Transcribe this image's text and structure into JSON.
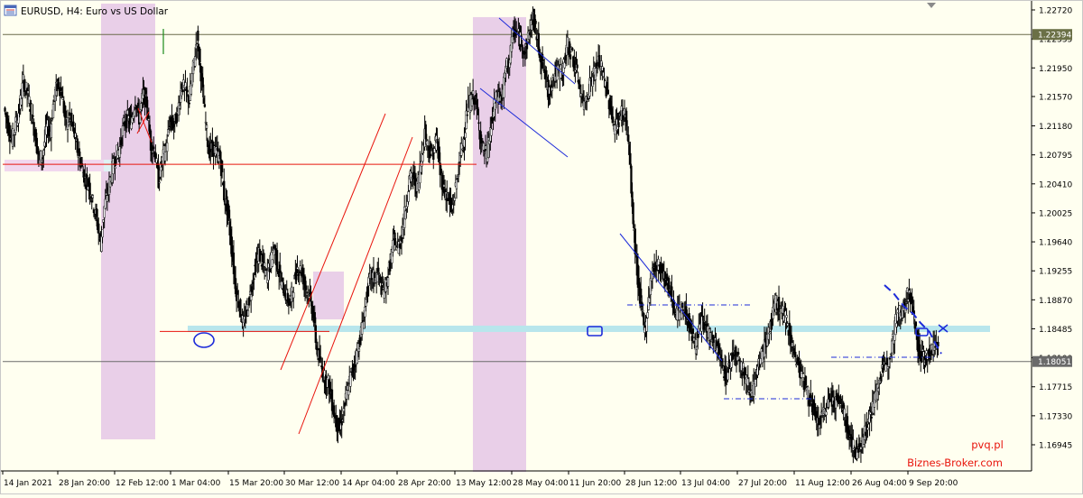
{
  "header": {
    "title": "EURUSD, H4:  Euro vs US Dollar",
    "icon": "chart-window-icon"
  },
  "watermark": {
    "line1": "pvq.pl",
    "line2": "Biznes-Broker.com",
    "color": "#e8140c"
  },
  "colors": {
    "background": "#fffff0",
    "candles": "#000000",
    "zone": "#e9cfe8",
    "support_band": "#b8e6ec",
    "red_lines": "#e8140c",
    "blue_lines": "#1d2bd9",
    "grid_line": "#7a7a7a",
    "price_line": "#6a6a6a"
  },
  "chart_data": {
    "type": "line",
    "symbol": "EURUSD",
    "timeframe": "H4",
    "title": "EURUSD, H4:  Euro vs US Dollar",
    "ylim": [
      1.1665,
      1.2275
    ],
    "y_ticks": [
      1.2272,
      1.22335,
      1.2195,
      1.2157,
      1.2118,
      1.20795,
      1.2041,
      1.20025,
      1.1964,
      1.19255,
      1.1887,
      1.18485,
      1.181,
      1.17715,
      1.1733,
      1.16945
    ],
    "y_tick_labels": [
      "1.22720",
      "1.22335",
      "1.21950",
      "1.21570",
      "1.21180",
      "1.20795",
      "1.20410",
      "1.20025",
      "1.19640",
      "1.19255",
      "1.18870",
      "1.18485",
      "1.18100",
      "1.17715",
      "1.17330",
      "1.16945"
    ],
    "x_tick_labels": [
      "14 Jan 2021",
      "28 Jan 20:00",
      "12 Feb 12:00",
      "1 Mar 04:00",
      "15 Mar 20:00",
      "30 Mar 12:00",
      "14 Apr 04:00",
      "28 Apr 20:00",
      "13 May 12:00",
      "28 May 04:00",
      "11 Jun 20:00",
      "28 Jun 12:00",
      "13 Jul 04:00",
      "27 Jul 20:00",
      "11 Aug 12:00",
      "26 Aug 04:00",
      "9 Sep 20:00"
    ],
    "price_labels": [
      {
        "value": 1.22394,
        "label": "1.22394",
        "style": "level"
      },
      {
        "value": 1.18051,
        "label": "1.18051",
        "style": "current"
      }
    ],
    "series": [
      {
        "values": [
          1.2142,
          1.2118,
          1.2098,
          1.2121,
          1.2142,
          1.2178,
          1.2162,
          1.2139,
          1.2107,
          1.2075,
          1.2078,
          1.2116,
          1.2112,
          1.2158,
          1.2176,
          1.2161,
          1.2119,
          1.2129,
          1.2112,
          1.2086,
          1.2066,
          1.2047,
          1.204,
          1.2016,
          1.1994,
          1.196,
          1.201,
          1.2034,
          1.206,
          1.2079,
          1.2089,
          1.212,
          1.2128,
          1.2123,
          1.2154,
          1.2128,
          1.2161,
          1.2147,
          1.2093,
          1.2085,
          1.2045,
          1.2072,
          1.2092,
          1.2124,
          1.2119,
          1.2137,
          1.2173,
          1.2165,
          1.2151,
          1.2195,
          1.2236,
          1.2188,
          1.2134,
          1.2084,
          1.2089,
          1.2082,
          1.2075,
          1.2025,
          1.2003,
          1.1953,
          1.1903,
          1.1877,
          1.1852,
          1.1875,
          1.1901,
          1.193,
          1.1949,
          1.1934,
          1.1919,
          1.1937,
          1.1957,
          1.1928,
          1.1906,
          1.1894,
          1.1881,
          1.1907,
          1.193,
          1.1926,
          1.1906,
          1.1892,
          1.1872,
          1.1822,
          1.1802,
          1.1784,
          1.1777,
          1.175,
          1.1724,
          1.1715,
          1.1741,
          1.1768,
          1.179,
          1.1807,
          1.1831,
          1.1858,
          1.1896,
          1.1919,
          1.1917,
          1.1921,
          1.1898,
          1.1907,
          1.1935,
          1.1966,
          1.1955,
          1.1974,
          1.2009,
          1.2047,
          1.205,
          1.2035,
          1.2071,
          1.211,
          1.2088,
          1.2078,
          1.2103,
          1.2056,
          1.2033,
          1.2022,
          1.2005,
          1.2036,
          1.2072,
          1.21,
          1.2139,
          1.2153,
          1.2156,
          1.2119,
          1.2088,
          1.2079,
          1.2109,
          1.2144,
          1.216,
          1.2154,
          1.2194,
          1.2207,
          1.2246,
          1.2239,
          1.2231,
          1.2215,
          1.2242,
          1.2262,
          1.2237,
          1.221,
          1.2189,
          1.216,
          1.2179,
          1.2188,
          1.219,
          1.2198,
          1.2225,
          1.2215,
          1.2195,
          1.2174,
          1.2146,
          1.2159,
          1.2178,
          1.219,
          1.2203,
          1.219,
          1.2167,
          1.2145,
          1.2117,
          1.2122,
          1.2136,
          1.2133,
          1.208,
          1.1988,
          1.1924,
          1.188,
          1.1845,
          1.1888,
          1.1929,
          1.1931,
          1.1933,
          1.1918,
          1.1906,
          1.1892,
          1.1869,
          1.1871,
          1.1876,
          1.1864,
          1.1845,
          1.1826,
          1.1845,
          1.1859,
          1.1849,
          1.1838,
          1.1831,
          1.1819,
          1.1799,
          1.1784,
          1.1803,
          1.182,
          1.1814,
          1.1799,
          1.1786,
          1.1771,
          1.1768,
          1.1786,
          1.1809,
          1.1825,
          1.1843,
          1.1862,
          1.1884,
          1.1877,
          1.1866,
          1.1857,
          1.1831,
          1.1809,
          1.1798,
          1.1782,
          1.1767,
          1.175,
          1.1735,
          1.1722,
          1.1731,
          1.1747,
          1.1757,
          1.1754,
          1.1751,
          1.1748,
          1.1726,
          1.1708,
          1.1693,
          1.1681,
          1.1698,
          1.1714,
          1.1725,
          1.1744,
          1.1764,
          1.1785,
          1.1796,
          1.1808,
          1.1831,
          1.1857,
          1.1872,
          1.1874,
          1.1895,
          1.1886,
          1.1856,
          1.1818,
          1.1812,
          1.181,
          1.1818,
          1.1829,
          1.1817
        ]
      }
    ],
    "annotations": {
      "zones": [
        {
          "label": "zone-1",
          "x_from": "12 Feb 12:00",
          "x_to": "1 Mar 04:00"
        },
        {
          "label": "zone-2",
          "x_from": "13 May 12:00",
          "x_to": "28 May 04:00"
        }
      ],
      "horizontal_lines": [
        1.2067,
        1.1845,
        1.18485,
        1.22394,
        1.18051
      ],
      "trend_channels": [
        "rising channel Mar-Apr",
        "falling channel May",
        "descending trendline Jun-Jul"
      ]
    }
  }
}
